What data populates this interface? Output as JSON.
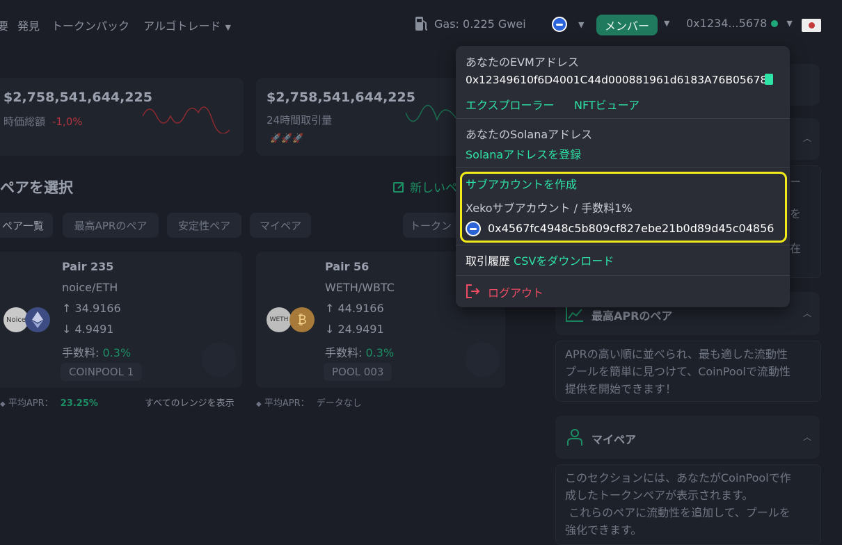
{
  "nav": {
    "items": [
      "要",
      "発見",
      "トークンパック",
      "アルゴトレード"
    ],
    "gas": "Gas: 0.225 Gwei",
    "member": "メンバー",
    "address": "0x1234...5678"
  },
  "stats": [
    {
      "value": "$2,758,541,644,225",
      "label": "時価総額",
      "change": "-1,0%"
    },
    {
      "value": "$2,758,541,644,225",
      "label": "24時間取引量",
      "emoji": "🚀🚀🚀"
    }
  ],
  "pairs_section": {
    "title": "ペアを選択",
    "new_pair": "新しいペ",
    "tabs": [
      "ペア一覧",
      "最高APRのペア",
      "安定性ペア",
      "マイペア",
      "トークン"
    ],
    "cards": [
      {
        "name": "Pair 235",
        "symbol": "noice/ETH",
        "up": "↑ 34.9166",
        "down": "↓ 4.9491",
        "fee_label": "手数料:",
        "fee": "0.3%",
        "pool": "COINPOOL 1",
        "avatar_text": "Noice"
      },
      {
        "name": "Pair 56",
        "symbol": "WETH/WBTC",
        "up": "↑ 44.9166",
        "down": "↓ 24.9491",
        "fee_label": "手数料:",
        "fee": "0.3%",
        "pool": "POOL 003",
        "avatar_text": "WETH"
      }
    ],
    "apr1_label": "平均APR：",
    "apr1_value": "23.25%",
    "show_range": "すべてのレンジを表示",
    "apr2_label": "平均APR：",
    "apr2_value": "データなし"
  },
  "sidebar": {
    "partial_text1": "を",
    "partial_text2": "在",
    "partial_text3": "ー",
    "best_apr_title": "最高APRのペア",
    "best_apr_text": [
      "APRの高い順に並べられ、最も適した流動性",
      "プールを簡単に見つけて、CoinPoolで流動性",
      "提供を開始できます！"
    ],
    "my_pair_title": "マイペア",
    "my_pair_text": [
      "このセクションには、あなたがCoinPoolで作",
      "成したトークンペアが表示されます。",
      " これらのペアに流動性を追加して、プールを",
      "強化できます。"
    ]
  },
  "dropdown": {
    "evm_label": "あなたのEVMアドレス",
    "evm_address": "0x12349610f6D4001C44d000881961d6183A76B05678",
    "explorer": "エクスプローラー",
    "nft_viewer": "NFTビューア",
    "solana_label": "あなたのSolanaアドレス",
    "solana_register": "Solanaアドレスを登録",
    "create_sub": "サブアカウントを作成",
    "sub_label": "Xekoサブアカウント / 手数料1%",
    "sub_address": "0x4567fc4948c5b809cf827ebe21b0d89d45c04856",
    "history_label": "取引履歴",
    "csv_download": "CSVをダウンロード",
    "logout": "ログアウト"
  }
}
